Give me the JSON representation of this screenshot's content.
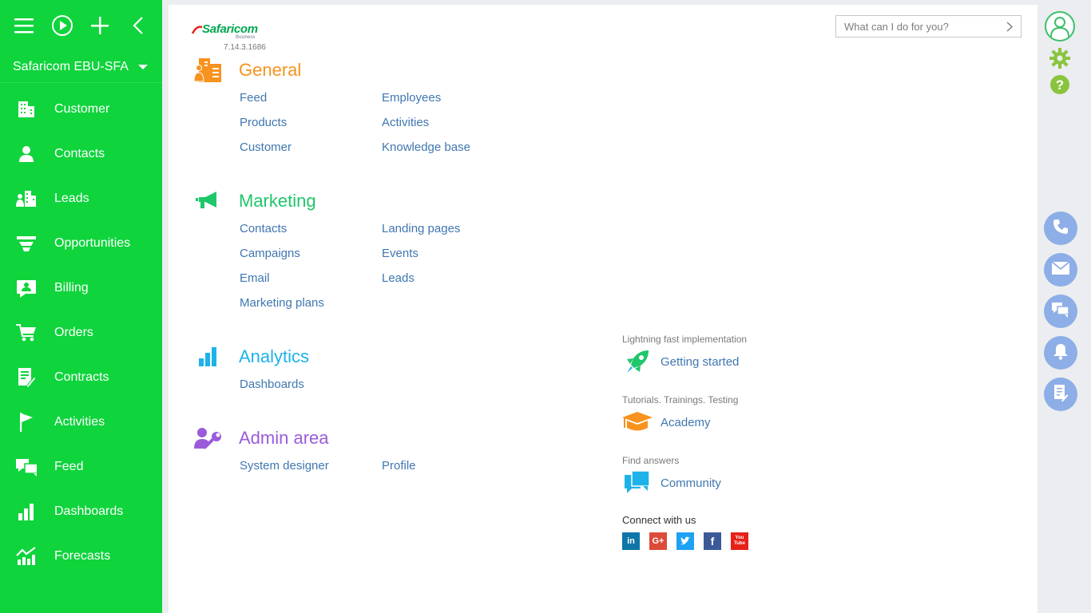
{
  "sidebar": {
    "workspace": "Safaricom EBU-SFA",
    "items": [
      {
        "label": "Customer",
        "icon": "building-icon"
      },
      {
        "label": "Contacts",
        "icon": "person-icon"
      },
      {
        "label": "Leads",
        "icon": "leads-icon"
      },
      {
        "label": "Opportunities",
        "icon": "funnel-icon"
      },
      {
        "label": "Billing",
        "icon": "billing-icon"
      },
      {
        "label": "Orders",
        "icon": "cart-icon"
      },
      {
        "label": "Contracts",
        "icon": "contract-icon"
      },
      {
        "label": "Activities",
        "icon": "flag-icon"
      },
      {
        "label": "Feed",
        "icon": "chat-icon"
      },
      {
        "label": "Dashboards",
        "icon": "bar-chart-icon"
      },
      {
        "label": "Forecasts",
        "icon": "forecast-icon"
      }
    ]
  },
  "header": {
    "brand": "Safaricom",
    "brand_sub": "Business",
    "version": "7.14.3.1686",
    "search_placeholder": "What can I do for you?"
  },
  "sections": {
    "general": {
      "title": "General",
      "color": "#f7931e",
      "col1": [
        "Feed",
        "Products",
        "Customer"
      ],
      "col2": [
        "Employees",
        "Activities",
        "Knowledge base"
      ]
    },
    "marketing": {
      "title": "Marketing",
      "color": "#1fc66b",
      "col1": [
        "Contacts",
        "Campaigns",
        "Email",
        "Marketing plans"
      ],
      "col2": [
        "Landing pages",
        "Events",
        "Leads"
      ]
    },
    "analytics": {
      "title": "Analytics",
      "color": "#1db3e8",
      "col1": [
        "Dashboards"
      ]
    },
    "admin": {
      "title": "Admin area",
      "color": "#9a5bdb",
      "col1": [
        "System designer"
      ],
      "col2": [
        "Profile"
      ]
    }
  },
  "extras": {
    "getting_started_caption": "Lightning fast implementation",
    "getting_started_label": "Getting started",
    "academy_caption": "Tutorials. Trainings. Testing",
    "academy_label": "Academy",
    "community_caption": "Find answers",
    "community_label": "Community",
    "connect_caption": "Connect with us",
    "social": [
      "in",
      "G+",
      "twitter",
      "f",
      "You Tube"
    ]
  },
  "colors": {
    "sidebar": "#0fd43c",
    "link": "#4077b0",
    "rightbar_button": "#8daee6"
  }
}
